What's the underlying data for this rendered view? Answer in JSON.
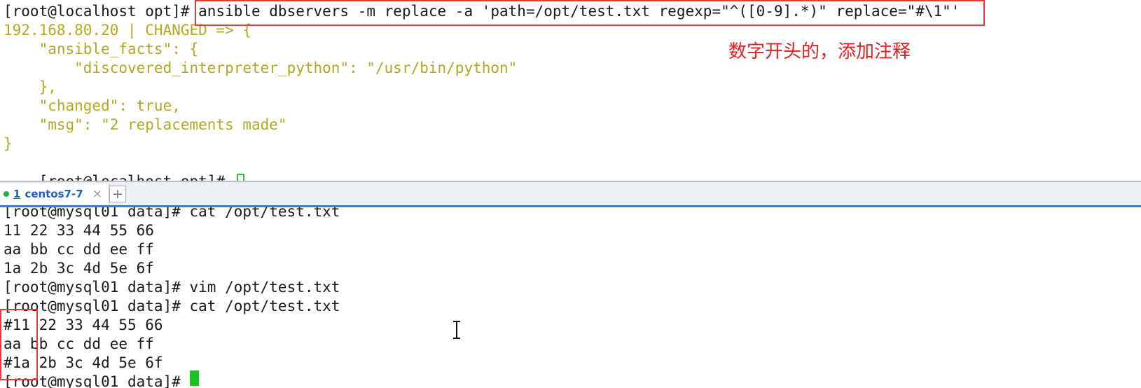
{
  "top_terminal": {
    "lines": [
      "[root@localhost opt]# ansible dbservers -m replace -a 'path=/opt/test.txt regexp=\"^([0-9].*)\" replace=\"#\\1\"'",
      "192.168.80.20 | CHANGED => {",
      "    \"ansible_facts\": {",
      "        \"discovered_interpreter_python\": \"/usr/bin/python\"",
      "    },",
      "    \"changed\": true,",
      "    \"msg\": \"2 replacements made\"",
      "}",
      "[root@localhost opt]# "
    ],
    "annotation": "数字开头的，添加注释",
    "highlight_color": "#e43a3a",
    "output_color": "#b3a81f"
  },
  "tabs": [
    {
      "number": "1",
      "label": "centos7-7",
      "close": "×",
      "active": true
    }
  ],
  "tab_add_label": "+",
  "bottom_terminal": {
    "lines": [
      "[root@mysql01 data]# cat /opt/test.txt",
      "11 22 33 44 55 66",
      "aa bb cc dd ee ff",
      "1a 2b 3c 4d 5e 6f",
      "[root@mysql01 data]# vim /opt/test.txt",
      "[root@mysql01 data]# cat /opt/test.txt",
      "#11 22 33 44 55 66",
      "aa bb cc dd ee ff",
      "#1a 2b 3c 4d 5e 6f",
      "[root@mysql01 data]# "
    ],
    "cursor_color": "#19c31f"
  }
}
